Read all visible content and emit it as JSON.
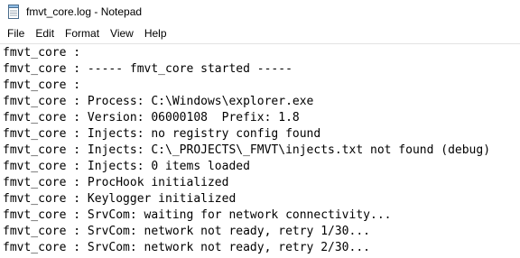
{
  "window": {
    "title": "fmvt_core.log - Notepad",
    "icon": "notepad-icon"
  },
  "menubar": {
    "items": [
      "File",
      "Edit",
      "Format",
      "View",
      "Help"
    ]
  },
  "editor": {
    "lines": [
      "fmvt_core :",
      "fmvt_core : ----- fmvt_core started -----",
      "fmvt_core :",
      "fmvt_core : Process: C:\\Windows\\explorer.exe",
      "fmvt_core : Version: 06000108  Prefix: 1.8",
      "fmvt_core : Injects: no registry config found",
      "fmvt_core : Injects: C:\\_PROJECTS\\_FMVT\\injects.txt not found (debug)",
      "fmvt_core : Injects: 0 items loaded",
      "fmvt_core : ProcHook initialized",
      "fmvt_core : Keylogger initialized",
      "fmvt_core : SrvCom: waiting for network connectivity...",
      "fmvt_core : SrvCom: network not ready, retry 1/30...",
      "fmvt_core : SrvCom: network not ready, retry 2/30..."
    ]
  }
}
